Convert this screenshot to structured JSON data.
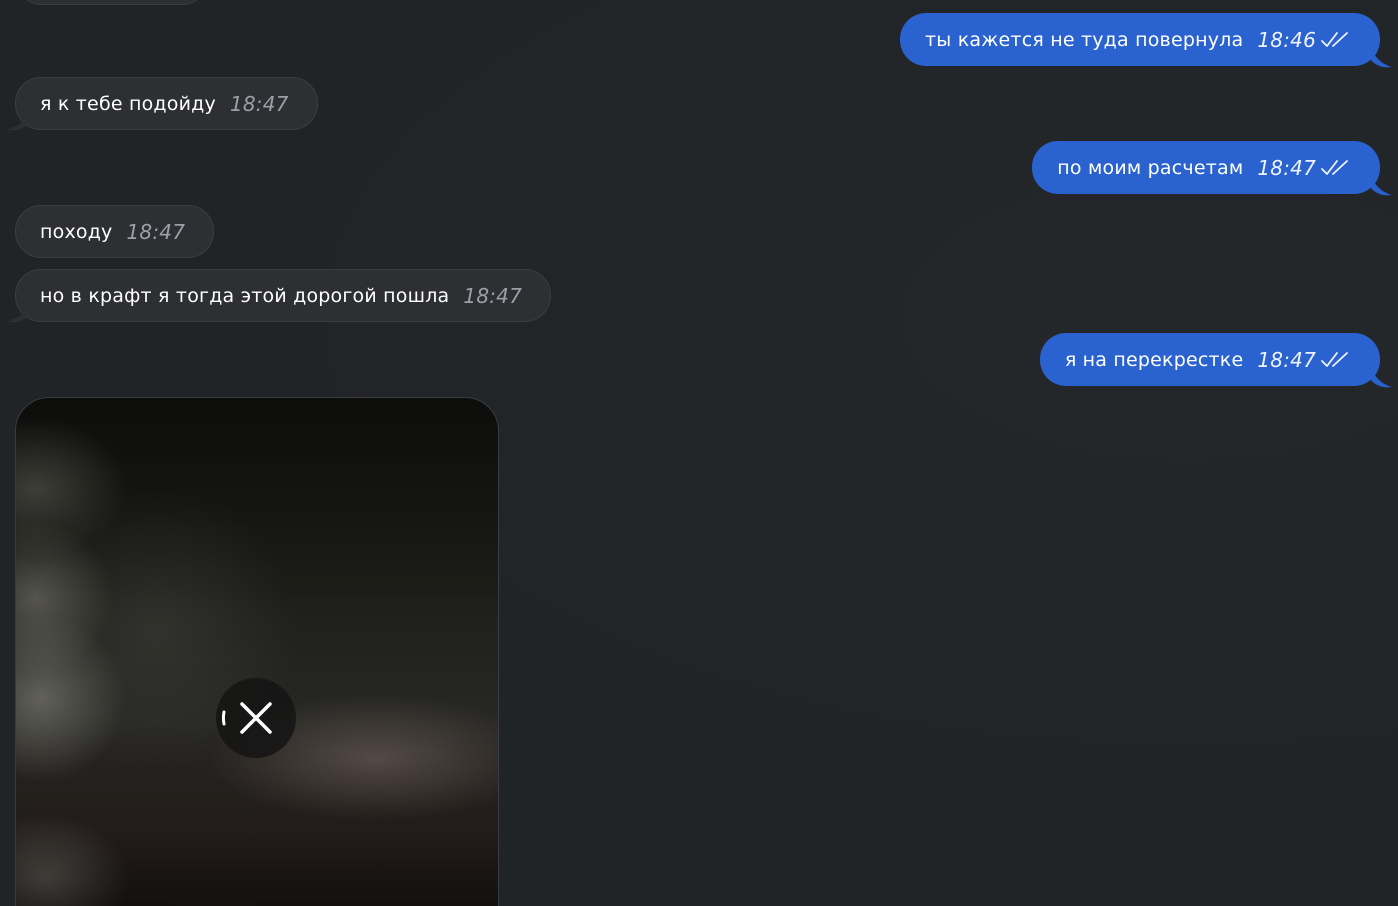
{
  "messages": [
    {
      "direction": "out",
      "text": "ты кажется не туда повернула",
      "time": "18:46",
      "status": "read"
    },
    {
      "direction": "in",
      "text": "я к тебе подойду",
      "time": "18:47"
    },
    {
      "direction": "out",
      "text": "по моим расчетам",
      "time": "18:47",
      "status": "read"
    },
    {
      "direction": "in",
      "text": "походу",
      "time": "18:47"
    },
    {
      "direction": "in",
      "text": "но в крафт я тогда этой дорогой пошла",
      "time": "18:47"
    },
    {
      "direction": "out",
      "text": "я на перекрестке",
      "time": "18:47",
      "status": "read"
    }
  ],
  "media": {
    "type": "video-loading",
    "icon": "close-icon"
  },
  "colors": {
    "background": "#212427",
    "incoming_bubble": "#2d2f33",
    "outgoing_bubble": "#2a62cf"
  }
}
